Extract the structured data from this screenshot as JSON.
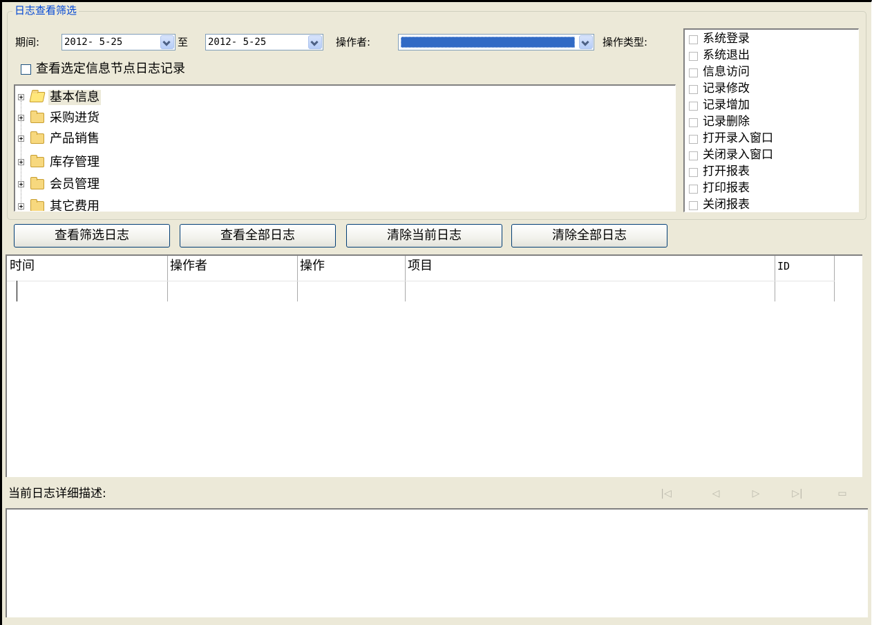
{
  "filter": {
    "group_title": "日志查看筛选",
    "period_label": "期间:",
    "date_from": "2012- 5-25",
    "to_label": "至",
    "date_to": "2012- 5-25",
    "operator_label": "操作者:",
    "operator_value": "",
    "operation_type_label": "操作类型:",
    "node_check_label": "查看选定信息节点日志记录"
  },
  "tree": {
    "items": [
      {
        "label": "基本信息",
        "selected": true,
        "open": true
      },
      {
        "label": "采购进货"
      },
      {
        "label": "产品销售"
      },
      {
        "label": "库存管理"
      },
      {
        "label": "会员管理"
      },
      {
        "label": "其它费用"
      }
    ]
  },
  "operation_types": [
    {
      "label": "系统登录"
    },
    {
      "label": "系统退出"
    },
    {
      "label": "信息访问"
    },
    {
      "label": "记录修改"
    },
    {
      "label": "记录增加"
    },
    {
      "label": "记录删除"
    },
    {
      "label": "打开录入窗口"
    },
    {
      "label": "关闭录入窗口"
    },
    {
      "label": "打开报表"
    },
    {
      "label": "打印报表"
    },
    {
      "label": "关闭报表"
    }
  ],
  "buttons": {
    "view_filtered": "查看筛选日志",
    "view_all": "查看全部日志",
    "clear_current": "清除当前日志",
    "clear_all": "清除全部日志"
  },
  "log_table": {
    "columns": [
      "时间",
      "操作者",
      "操作",
      "项目",
      "ID"
    ]
  },
  "details": {
    "label": "当前日志详细描述:"
  },
  "navigator": {
    "first": "|◁",
    "prev": "◁",
    "next": "▷",
    "last": "▷|",
    "extra": "▭"
  },
  "colors": {
    "background": "#ece9d8",
    "group_title": "#0046d5",
    "operator_selection": "#316ac5"
  }
}
